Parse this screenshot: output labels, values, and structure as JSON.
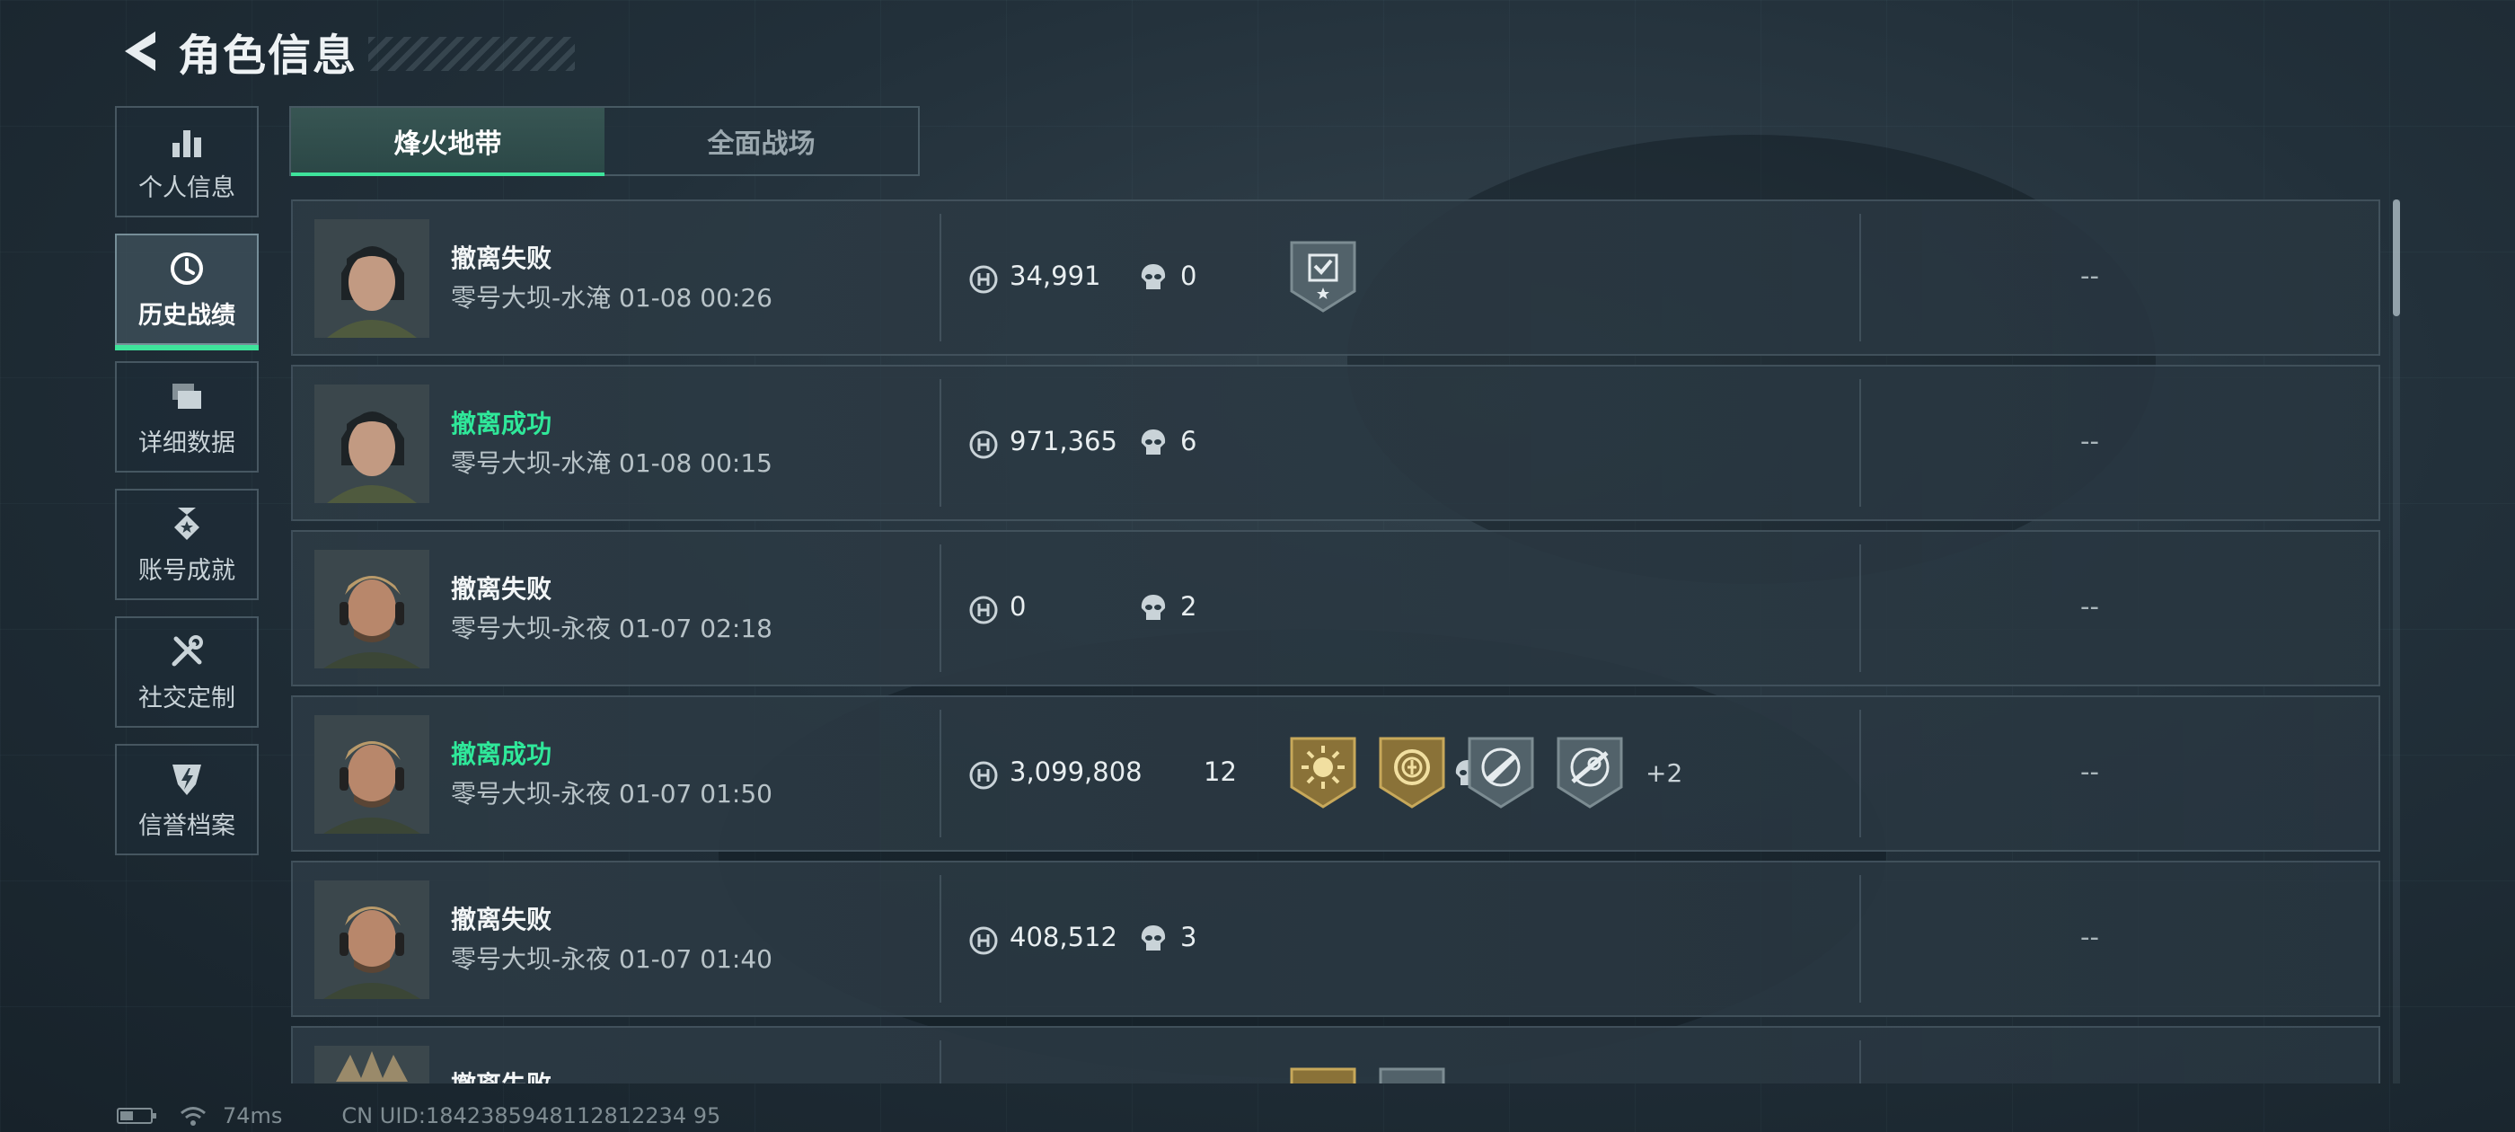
{
  "header": {
    "title": "角色信息"
  },
  "sidebar": {
    "items": [
      {
        "label": "个人信息",
        "icon": "bar-chart-icon",
        "active": false
      },
      {
        "label": "历史战绩",
        "icon": "history-clock-icon",
        "active": true
      },
      {
        "label": "详细数据",
        "icon": "cards-icon",
        "active": false
      },
      {
        "label": "账号成就",
        "icon": "medal-icon",
        "active": false
      },
      {
        "label": "社交定制",
        "icon": "tools-icon",
        "active": false
      },
      {
        "label": "信誉档案",
        "icon": "shield-lightning-icon",
        "active": false
      }
    ]
  },
  "tabs": [
    {
      "label": "烽火地带",
      "active": true
    },
    {
      "label": "全面战场",
      "active": false
    }
  ],
  "colors": {
    "success": "#2fe89a",
    "accent": "#3ee39b"
  },
  "records": [
    {
      "status": "撤离失败",
      "success": false,
      "map_time": "零号大坝-水淹 01-08 00:26",
      "coins": "34,991",
      "kills": "0",
      "badges": [
        "checklist-star-badge"
      ],
      "more": "",
      "extra": "--",
      "operator": "female"
    },
    {
      "status": "撤离成功",
      "success": true,
      "map_time": "零号大坝-水淹 01-08 00:15",
      "coins": "971,365",
      "kills": "6",
      "badges": [],
      "more": "",
      "extra": "--",
      "operator": "female"
    },
    {
      "status": "撤离失败",
      "success": false,
      "map_time": "零号大坝-永夜 01-07 02:18",
      "coins": "0",
      "kills": "2",
      "badges": [],
      "more": "",
      "extra": "--",
      "operator": "male"
    },
    {
      "status": "撤离成功",
      "success": true,
      "map_time": "零号大坝-永夜 01-07 01:50",
      "coins": "3,099,808",
      "kills": "12",
      "badges": [
        "sun-gold-badge",
        "coin-gold-badge",
        "rifle-badge",
        "sniper-badge"
      ],
      "more": "+2",
      "extra": "--",
      "operator": "male"
    },
    {
      "status": "撤离失败",
      "success": false,
      "map_time": "零号大坝-永夜 01-07 01:40",
      "coins": "408,512",
      "kills": "3",
      "badges": [],
      "more": "",
      "extra": "--",
      "operator": "male"
    },
    {
      "status": "撤离失败",
      "success": false,
      "map_time": "",
      "coins": "",
      "kills": "",
      "badges": [
        "gold-badge",
        "grey-badge"
      ],
      "more": "",
      "extra": "",
      "operator": "heavy"
    }
  ],
  "footer": {
    "ping": "74ms",
    "uid": "CN UID:1842385948112812234 95"
  }
}
